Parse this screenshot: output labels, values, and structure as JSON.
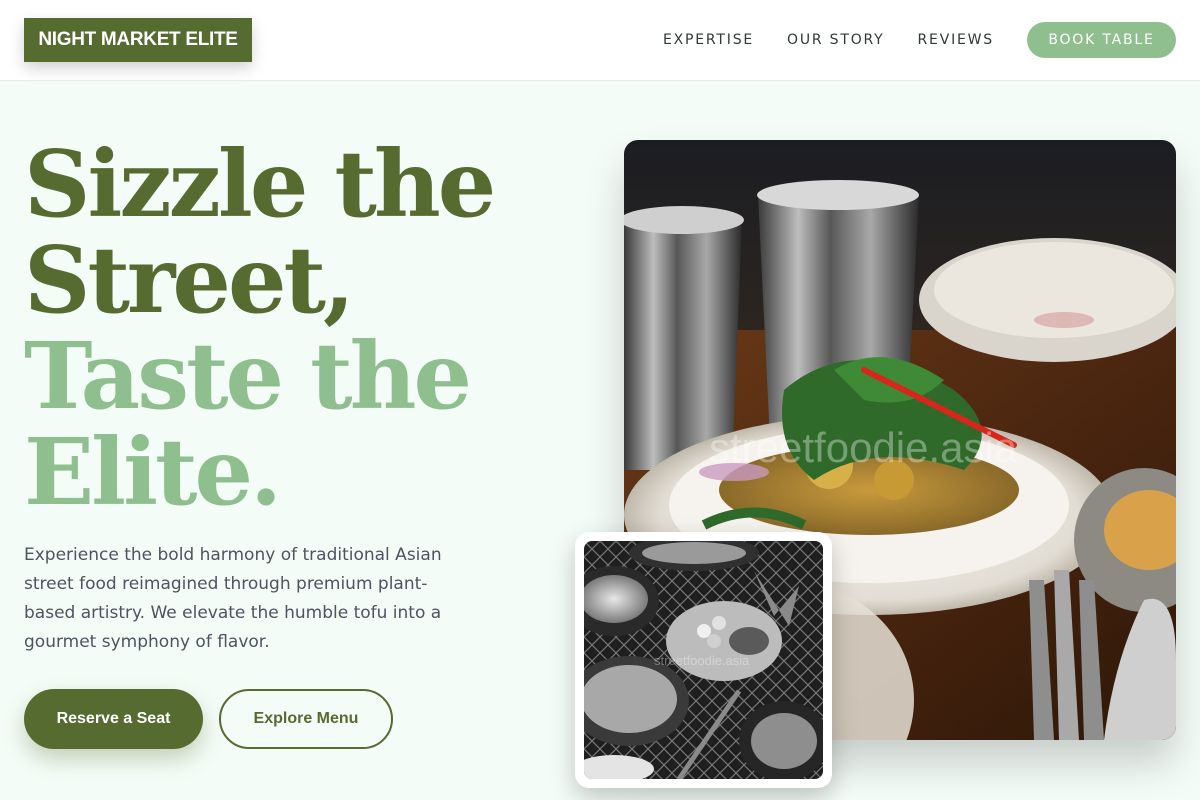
{
  "header": {
    "logo": "NIGHT MARKET ELITE",
    "nav": [
      "EXPERTISE",
      "OUR STORY",
      "REVIEWS"
    ],
    "cta": "BOOK TABLE"
  },
  "hero": {
    "title_line1": "Sizzle the",
    "title_line2": "Street,",
    "title_line3": "Taste the",
    "title_line4": "Elite.",
    "description": "Experience the bold harmony of traditional Asian street food reimagined through premium plant-based artistry. We elevate the humble tofu into a gourmet symphony of flavor.",
    "primary_button": "Reserve a Seat",
    "secondary_button": "Explore Menu"
  },
  "images": {
    "main_watermark": "streetfoodie.asia",
    "inset_watermark": "streetfoodie.asia"
  },
  "colors": {
    "accent_dark": "#556b2f",
    "accent_light": "#8fbf8f",
    "background": "#f4fcf7"
  }
}
